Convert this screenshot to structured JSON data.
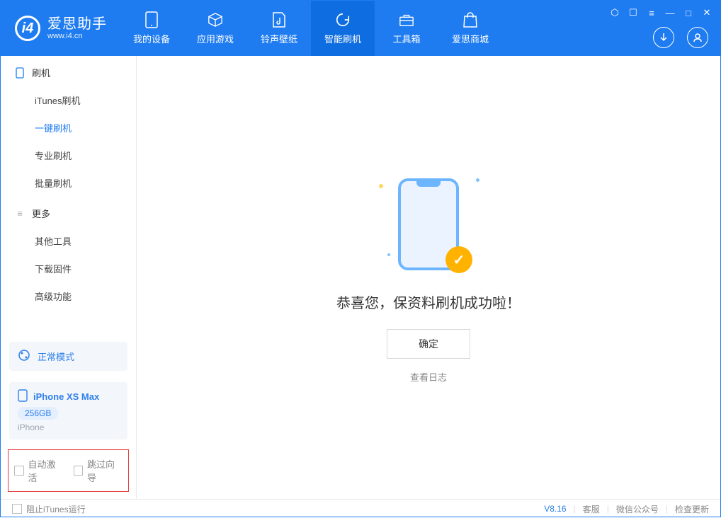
{
  "app": {
    "title": "爱思助手",
    "subtitle": "www.i4.cn"
  },
  "nav": {
    "items": [
      {
        "id": "device",
        "label": "我的设备"
      },
      {
        "id": "apps",
        "label": "应用游戏"
      },
      {
        "id": "rings",
        "label": "铃声壁纸"
      },
      {
        "id": "flash",
        "label": "智能刷机"
      },
      {
        "id": "toolbox",
        "label": "工具箱"
      },
      {
        "id": "store",
        "label": "爱思商城"
      }
    ],
    "active": "flash"
  },
  "sidebar": {
    "group1": {
      "title": "刷机",
      "items": [
        "iTunes刷机",
        "一键刷机",
        "专业刷机",
        "批量刷机"
      ],
      "active_index": 1
    },
    "group2": {
      "title": "更多",
      "items": [
        "其他工具",
        "下载固件",
        "高级功能"
      ]
    },
    "mode_card": "正常模式",
    "device_card": {
      "name": "iPhone XS Max",
      "capacity": "256GB",
      "type": "iPhone"
    },
    "options": {
      "auto_activate": "自动激活",
      "skip_guide": "跳过向导"
    }
  },
  "main": {
    "success_text": "恭喜您，保资料刷机成功啦！",
    "ok_button": "确定",
    "view_log": "查看日志"
  },
  "footer": {
    "block_itunes": "阻止iTunes运行",
    "version": "V8.16",
    "service": "客服",
    "wechat": "微信公众号",
    "check_update": "检查更新"
  }
}
